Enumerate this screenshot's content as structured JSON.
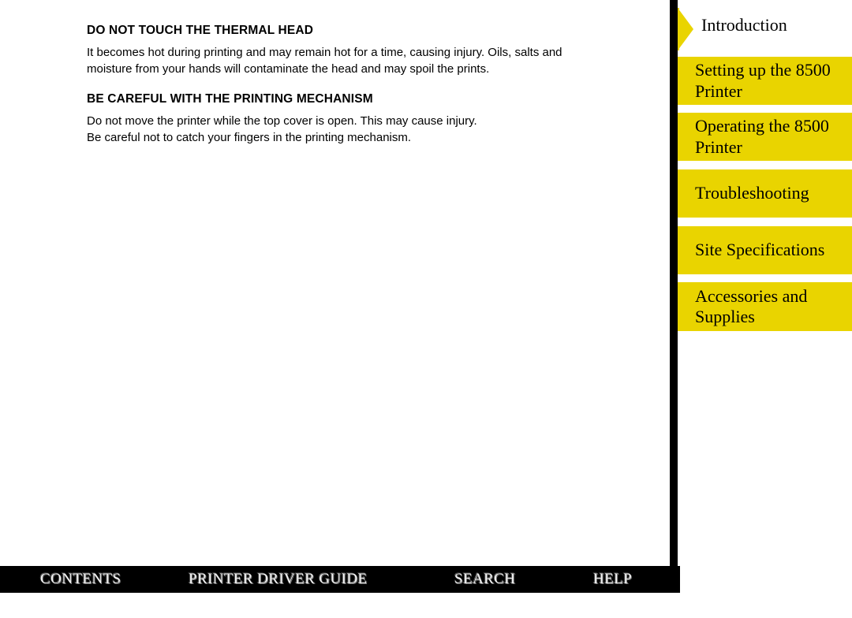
{
  "document": {
    "sections": [
      {
        "heading": "DO NOT TOUCH THE THERMAL HEAD",
        "body": "It becomes hot during printing and may remain hot for a time, causing injury.  Oils, salts and\nmoisture from your hands will contaminate the head and may spoil the prints."
      },
      {
        "heading": "BE CAREFUL WITH THE PRINTING MECHANISM",
        "body": "Do not move the printer while the top cover is open.  This may cause injury.\nBe careful not to catch your fingers in the printing mechanism."
      }
    ]
  },
  "sidebar": {
    "items": [
      {
        "label": "Introduction",
        "current": true
      },
      {
        "label": "Setting up the 8500 Printer",
        "current": false
      },
      {
        "label": "Operating the 8500 Printer",
        "current": false
      },
      {
        "label": "Troubleshooting",
        "current": false
      },
      {
        "label": "Site Specifications",
        "current": false
      },
      {
        "label": "Accessories and Supplies",
        "current": false
      }
    ],
    "current_marker_icon": "right-arrow-icon",
    "accent_color": "#e9d400"
  },
  "bottombar": {
    "background_color": "#000000",
    "text_color": "#f2f2f2",
    "links": [
      {
        "label": "CONTENTS"
      },
      {
        "label": "PRINTER DRIVER GUIDE"
      },
      {
        "label": "SEARCH"
      },
      {
        "label": "HELP"
      }
    ]
  }
}
